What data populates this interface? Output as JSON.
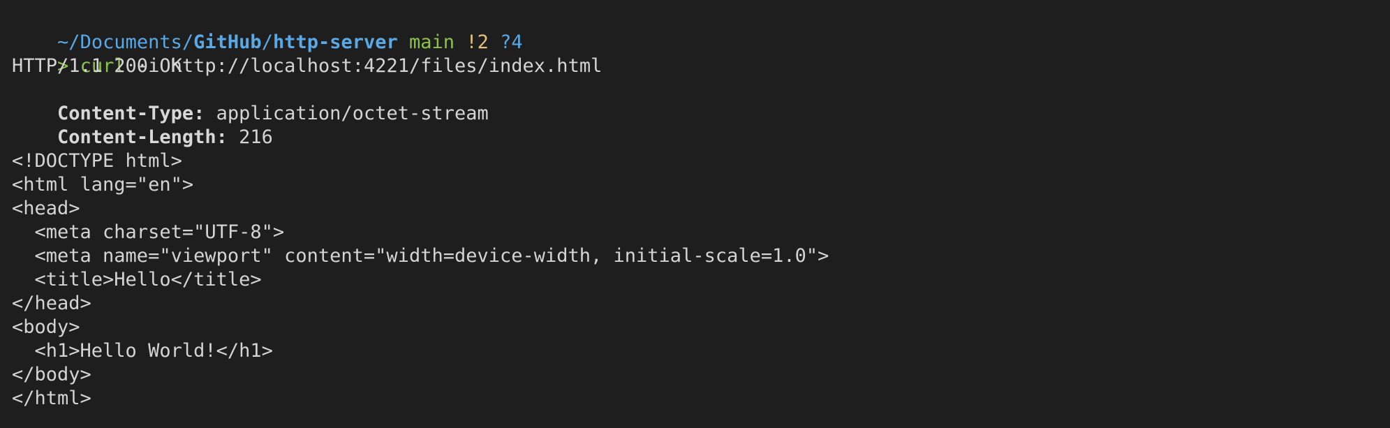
{
  "prompt": {
    "home": "~",
    "sep1": "/",
    "dir1": "Documents",
    "sep2": "/",
    "dir2": "GitHub",
    "sep3": "/",
    "dir3": "http-server",
    "branch": "main",
    "modified": "!2",
    "untracked": "?4"
  },
  "command": {
    "prompt_char": ">",
    "program": "curl",
    "args": "-i http://localhost:4221/files/index.html"
  },
  "response": {
    "status": "HTTP/1.1 200 OK",
    "headers": [
      {
        "name": "Content-Type:",
        "value": "application/octet-stream"
      },
      {
        "name": "Content-Length:",
        "value": "216"
      }
    ],
    "body_lines": [
      "<!DOCTYPE html>",
      "<html lang=\"en\">",
      "<head>",
      "  <meta charset=\"UTF-8\">",
      "  <meta name=\"viewport\" content=\"width=device-width, initial-scale=1.0\">",
      "  <title>Hello</title>",
      "</head>",
      "<body>",
      "  <h1>Hello World!</h1>",
      "</body>",
      "</html>"
    ]
  },
  "colors": {
    "background": "#1e1e1e",
    "text": "#d4d4d4",
    "path": "#5aa9e6",
    "branch": "#8bc34a",
    "modified": "#e5c07b"
  }
}
